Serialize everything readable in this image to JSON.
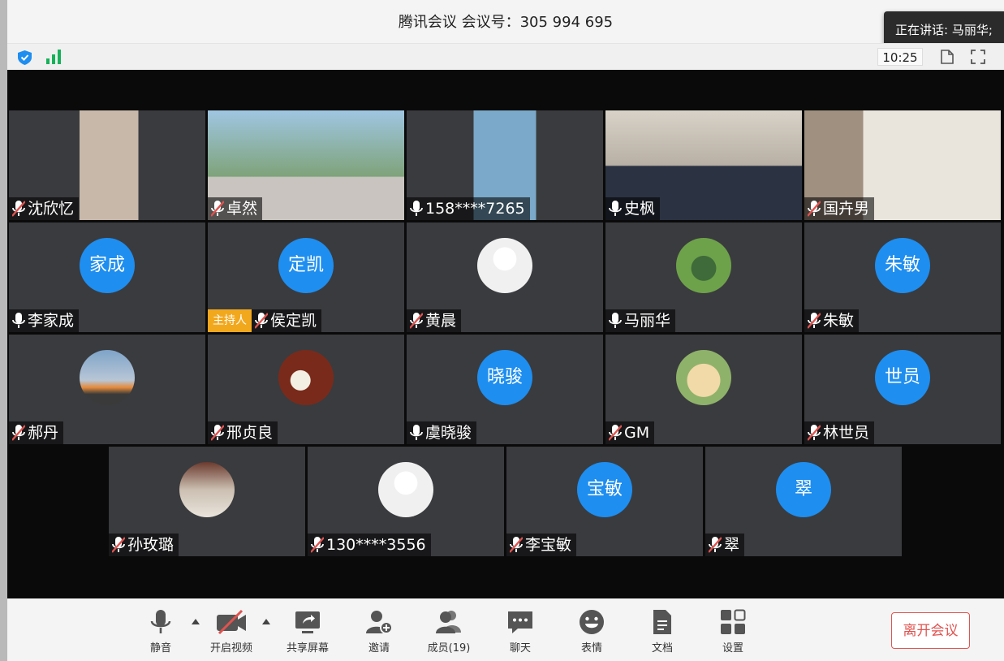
{
  "window": {
    "title": "腾讯会议 会议号：305 994 695"
  },
  "status": {
    "time": "10:25",
    "speaking": "正在讲话: 马丽华;"
  },
  "participants": [
    {
      "name": "沈欣忆",
      "mic": "muted",
      "type": "video"
    },
    {
      "name": "卓然",
      "mic": "muted",
      "type": "video"
    },
    {
      "name": "158****7265",
      "mic": "on",
      "type": "video"
    },
    {
      "name": "史枫",
      "mic": "on",
      "type": "video"
    },
    {
      "name": "国卉男",
      "mic": "muted",
      "type": "video"
    },
    {
      "name": "李家成",
      "mic": "on",
      "type": "avatar",
      "avatar_text": "家成"
    },
    {
      "name": "侯定凯",
      "mic": "muted",
      "type": "avatar",
      "avatar_text": "定凯",
      "badge": "主持人"
    },
    {
      "name": "黄晨",
      "mic": "muted",
      "type": "photo"
    },
    {
      "name": "马丽华",
      "mic": "on",
      "type": "photo"
    },
    {
      "name": "朱敏",
      "mic": "muted",
      "type": "avatar",
      "avatar_text": "朱敏"
    },
    {
      "name": "郝丹",
      "mic": "muted",
      "type": "photo"
    },
    {
      "name": "邢贞良",
      "mic": "muted",
      "type": "photo"
    },
    {
      "name": "虞晓骏",
      "mic": "on",
      "type": "avatar",
      "avatar_text": "晓骏"
    },
    {
      "name": "GM",
      "mic": "muted",
      "type": "photo"
    },
    {
      "name": "林世员",
      "mic": "muted",
      "type": "avatar",
      "avatar_text": "世员"
    },
    {
      "name": "孙玫璐",
      "mic": "muted",
      "type": "photo"
    },
    {
      "name": "130****3556",
      "mic": "muted",
      "type": "photo"
    },
    {
      "name": "李宝敏",
      "mic": "muted",
      "type": "avatar",
      "avatar_text": "宝敏"
    },
    {
      "name": "翠",
      "mic": "muted",
      "type": "avatar",
      "avatar_text": "翠"
    }
  ],
  "toolbar": {
    "mute": "静音",
    "video": "开启视频",
    "share": "共享屏幕",
    "invite": "邀请",
    "members": "成员(19)",
    "chat": "聊天",
    "emoji": "表情",
    "docs": "文档",
    "settings": "设置",
    "leave": "离开会议"
  },
  "colors": {
    "avatar_blue": "#1e8ef0",
    "host_badge": "#f2a81d",
    "leave_red": "#e0534f",
    "signal_green": "#16b25a"
  }
}
